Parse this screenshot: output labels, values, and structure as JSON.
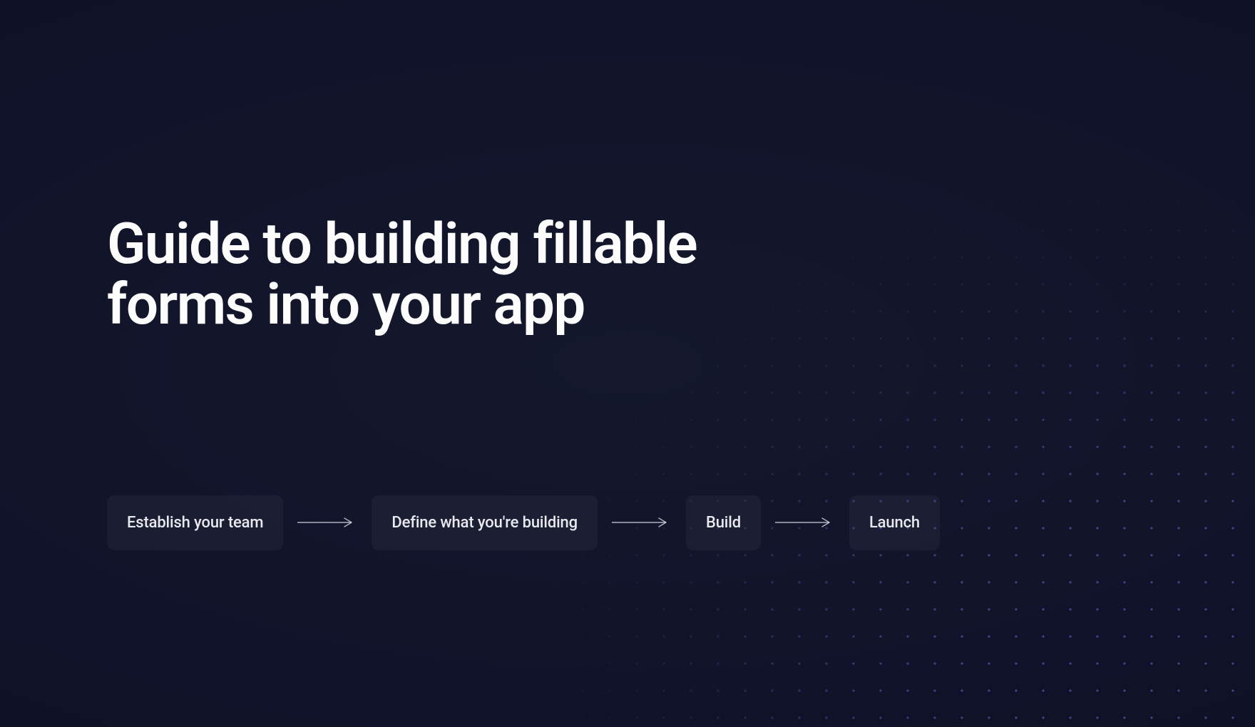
{
  "title": "Guide to building fillable forms into your app",
  "steps": [
    "Establish your team",
    "Define what you're building",
    "Build",
    "Launch"
  ],
  "colors": {
    "background": "#11132a",
    "text_primary": "#fcfcfd",
    "text_secondary": "#e9eaef",
    "step_bg": "rgba(255,255,255,0.04)",
    "dot": "rgba(110,110,220,0.55)"
  }
}
